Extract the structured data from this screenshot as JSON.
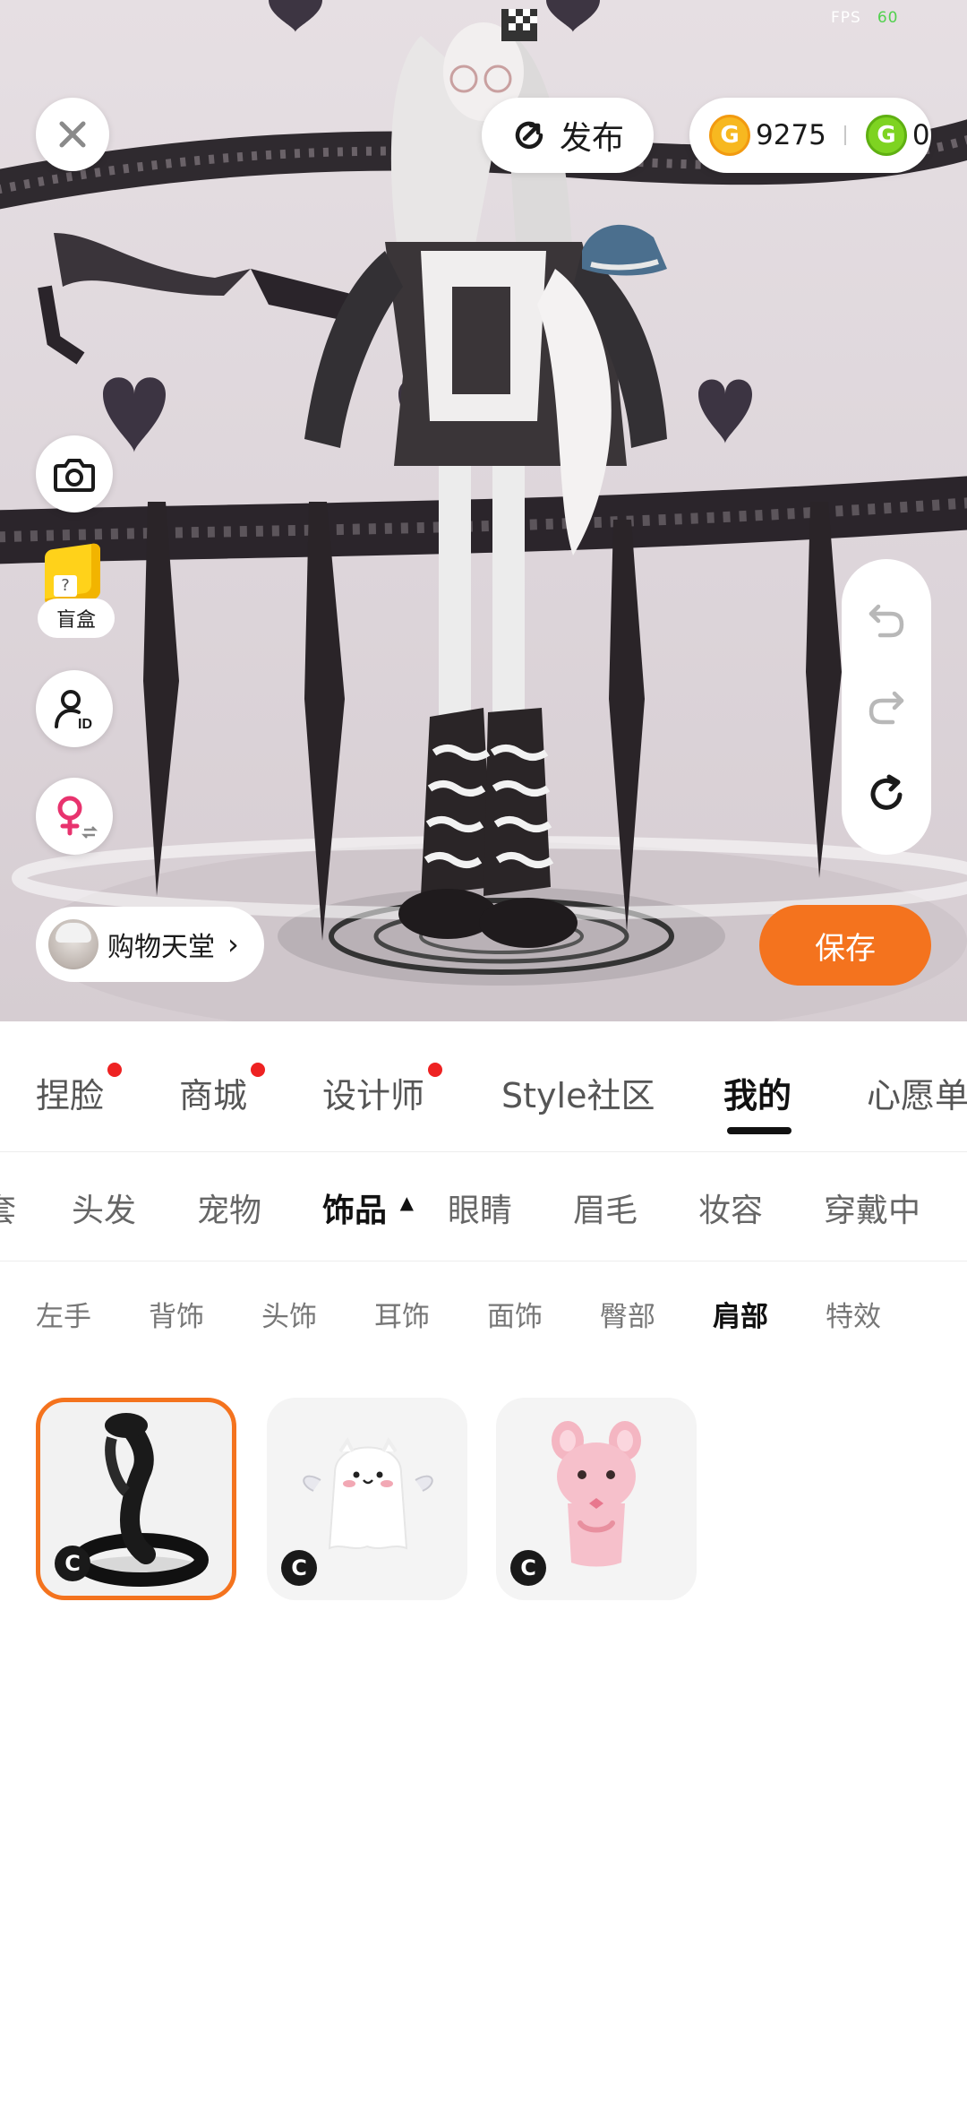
{
  "status": {
    "fps_label": "FPS",
    "fps_value": "60"
  },
  "topbar": {
    "close_icon": "close-icon",
    "publish_label": "发布",
    "currency": {
      "gold_symbol": "G",
      "gold_value": "9275",
      "green_symbol": "G",
      "green_value": "0"
    }
  },
  "left_tools": {
    "blindbox_label": "盲盒",
    "blindbox_symbol": "?"
  },
  "bottom_actions": {
    "shop_label": "购物天堂",
    "shop_chevron": "›",
    "save_label": "保存"
  },
  "tabs": [
    {
      "label": "捏脸",
      "dot": true
    },
    {
      "label": "商城",
      "dot": true
    },
    {
      "label": "设计师",
      "dot": true
    },
    {
      "label": "Style社区",
      "dot": false
    },
    {
      "label": "我的",
      "dot": false,
      "active": true
    },
    {
      "label": "心愿单",
      "dot": false
    }
  ],
  "categories": [
    {
      "label": "套"
    },
    {
      "label": "头发"
    },
    {
      "label": "宠物"
    },
    {
      "label": "饰品",
      "active": true
    },
    {
      "label": "眼睛"
    },
    {
      "label": "眉毛"
    },
    {
      "label": "妆容"
    },
    {
      "label": "穿戴中"
    }
  ],
  "category_active_indicator": "▲",
  "subcategories": [
    {
      "label": "左手"
    },
    {
      "label": "背饰"
    },
    {
      "label": "头饰"
    },
    {
      "label": "耳饰"
    },
    {
      "label": "面饰"
    },
    {
      "label": "臀部"
    },
    {
      "label": "肩部",
      "active": true
    },
    {
      "label": "特效"
    }
  ],
  "items": [
    {
      "name": "snake",
      "badge": "C",
      "selected": true
    },
    {
      "name": "ghost",
      "badge": "C",
      "selected": false
    },
    {
      "name": "pink-bunny",
      "badge": "C",
      "selected": false
    }
  ],
  "colors": {
    "accent": "#f4731e",
    "notify_dot": "#ee2222",
    "gold": "#f7b820",
    "green": "#7ed321"
  }
}
